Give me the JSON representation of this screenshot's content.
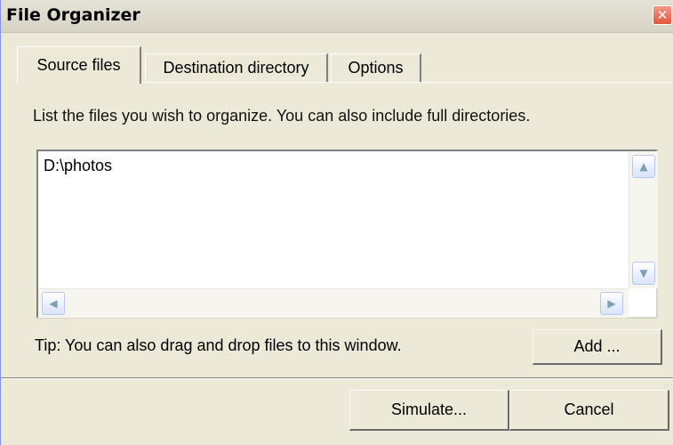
{
  "window": {
    "title": "File Organizer",
    "close_symbol": "✕",
    "close_icon": "close-icon"
  },
  "tabs": [
    {
      "label": "Source files",
      "active": true
    },
    {
      "label": "Destination directory",
      "active": false
    },
    {
      "label": "Options",
      "active": false
    }
  ],
  "source": {
    "instructions": "List the files you wish to organize. You can also include full directories.",
    "files": [
      "D:\\photos"
    ],
    "tip": "Tip: You can also drag and drop files to this window.",
    "add_label": "Add ..."
  },
  "scrollbars": {
    "up_symbol": "▲",
    "down_symbol": "▼",
    "left_symbol": "◀",
    "right_symbol": "▶"
  },
  "footer": {
    "simulate_label": "Simulate...",
    "cancel_label": "Cancel"
  }
}
